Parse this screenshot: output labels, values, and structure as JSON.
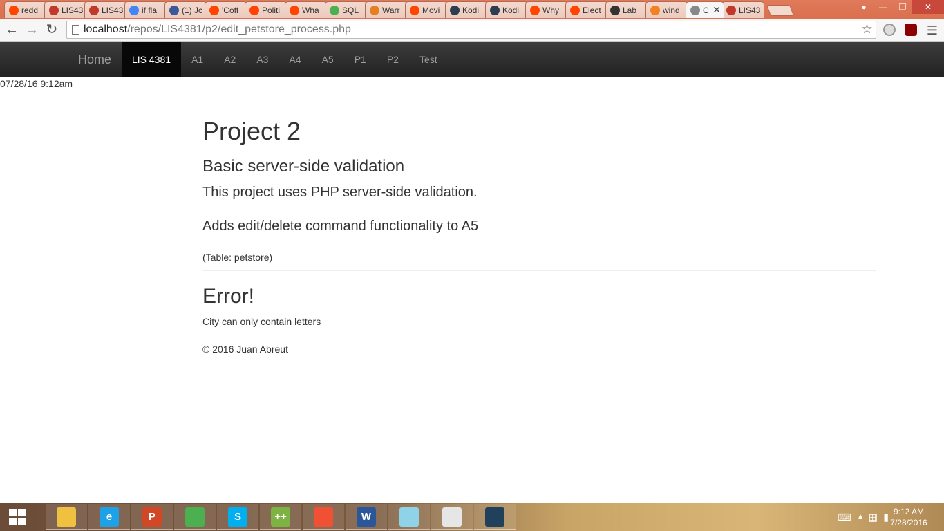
{
  "browser": {
    "tabs": [
      {
        "label": "redd",
        "icon": "reddit-icon",
        "color": "#ff4500"
      },
      {
        "label": "LIS43",
        "icon": "fsu-icon",
        "color": "#c0392b"
      },
      {
        "label": "LIS43",
        "icon": "fsu-icon",
        "color": "#c0392b"
      },
      {
        "label": "if fla",
        "icon": "google-icon",
        "color": "#4285f4"
      },
      {
        "label": "(1) Jc",
        "icon": "facebook-icon",
        "color": "#3b5998"
      },
      {
        "label": "'Coff",
        "icon": "reddit-icon",
        "color": "#ff4500"
      },
      {
        "label": "Politi",
        "icon": "reddit-icon",
        "color": "#ff4500"
      },
      {
        "label": "Wha",
        "icon": "reddit-icon",
        "color": "#ff4500"
      },
      {
        "label": "SQL",
        "icon": "w3schools-icon",
        "color": "#4caf50"
      },
      {
        "label": "Warr",
        "icon": "warrior-icon",
        "color": "#e67e22"
      },
      {
        "label": "Movi",
        "icon": "reddit-icon",
        "color": "#ff4500"
      },
      {
        "label": "Kodi",
        "icon": "kodi-icon",
        "color": "#2c3e50"
      },
      {
        "label": "Kodi",
        "icon": "kodi-icon",
        "color": "#2c3e50"
      },
      {
        "label": "Why",
        "icon": "reddit-icon",
        "color": "#ff4500"
      },
      {
        "label": "Elect",
        "icon": "reddit-icon",
        "color": "#ff4500"
      },
      {
        "label": "Lab",
        "icon": "blackboard-icon",
        "color": "#333333"
      },
      {
        "label": "wind",
        "icon": "stackoverflow-icon",
        "color": "#f48024"
      },
      {
        "label": "C",
        "icon": "page-icon",
        "color": "#888888",
        "active": true
      },
      {
        "label": "LIS43",
        "icon": "fsu-icon",
        "color": "#c0392b"
      }
    ],
    "url_host": "localhost",
    "url_path": "/repos/LIS4381/p2/edit_petstore_process.php"
  },
  "navbar": {
    "brand": "Home",
    "items": [
      {
        "label": "LIS 4381",
        "active": true
      },
      {
        "label": "A1"
      },
      {
        "label": "A2"
      },
      {
        "label": "A3"
      },
      {
        "label": "A4"
      },
      {
        "label": "A5"
      },
      {
        "label": "P1"
      },
      {
        "label": "P2"
      },
      {
        "label": "Test"
      }
    ]
  },
  "page": {
    "datetime": "07/28/16 9:12am",
    "title": "Project 2",
    "subtitle": "Basic server-side validation",
    "description": "This project uses PHP server-side validation.",
    "feature": "Adds edit/delete command functionality to A5",
    "table_note": "(Table: petstore)",
    "error_heading": "Error!",
    "error_message": "City can only contain letters",
    "footer": "© 2016 Juan Abreut"
  },
  "taskbar": {
    "apps": [
      {
        "icon": "file-explorer-icon",
        "color": "#f0c040",
        "label": ""
      },
      {
        "icon": "internet-explorer-icon",
        "color": "#1ea1e6",
        "label": "e"
      },
      {
        "icon": "powerpoint-icon",
        "color": "#d24726",
        "label": "P"
      },
      {
        "icon": "chrome-icon",
        "color": "#4caf50",
        "label": ""
      },
      {
        "icon": "skype-icon",
        "color": "#00aff0",
        "label": "S"
      },
      {
        "icon": "notepad-plus-plus-icon",
        "color": "#7cb342",
        "label": "++"
      },
      {
        "icon": "git-icon",
        "color": "#f05033",
        "label": ""
      },
      {
        "icon": "word-icon",
        "color": "#2b579a",
        "label": "W"
      },
      {
        "icon": "notepad-icon",
        "color": "#8fd3e8",
        "label": ""
      },
      {
        "icon": "paint-icon",
        "color": "#e6e6e6",
        "label": ""
      },
      {
        "icon": "mysql-workbench-icon",
        "color": "#21405c",
        "label": ""
      }
    ],
    "time": "9:12 AM",
    "date": "7/28/2016"
  }
}
